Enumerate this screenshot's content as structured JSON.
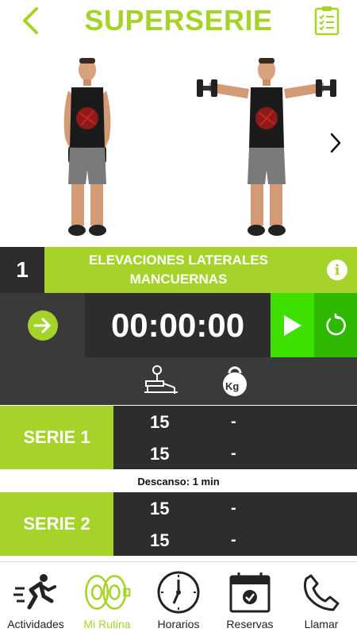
{
  "header": {
    "title": "SUPERSERIE",
    "back_icon": "chevron-left-icon",
    "clipboard_icon": "clipboard-checklist-icon"
  },
  "exercise": {
    "number": "1",
    "name_line1": "ELEVACIONES LATERALES",
    "name_line2": "MANCUERNAS",
    "info_symbol": "i"
  },
  "timer": {
    "value": "00:00:00"
  },
  "columns": {
    "reps_icon": "bench-press-icon",
    "weight_icon": "kettlebell-icon",
    "weight_unit": "Kg"
  },
  "series": [
    {
      "label": "SERIE 1",
      "rows": [
        {
          "reps": "15",
          "weight": "-"
        },
        {
          "reps": "15",
          "weight": "-"
        }
      ]
    },
    {
      "label": "SERIE 2",
      "rows": [
        {
          "reps": "15",
          "weight": "-"
        },
        {
          "reps": "15",
          "weight": "-"
        }
      ]
    }
  ],
  "rest_text": "Descanso: 1 min",
  "tabs": [
    {
      "label": "Actividades",
      "icon": "running-person-icon"
    },
    {
      "label": "Mi Rutina",
      "icon": "weight-plates-icon",
      "active": true
    },
    {
      "label": "Horarios",
      "icon": "clock-icon"
    },
    {
      "label": "Reservas",
      "icon": "calendar-check-icon"
    },
    {
      "label": "Llamar",
      "icon": "phone-icon"
    }
  ],
  "colors": {
    "accent": "#a6d32a",
    "play": "#3ee000",
    "reset": "#2fb800",
    "dark": "#2d2d2d"
  }
}
